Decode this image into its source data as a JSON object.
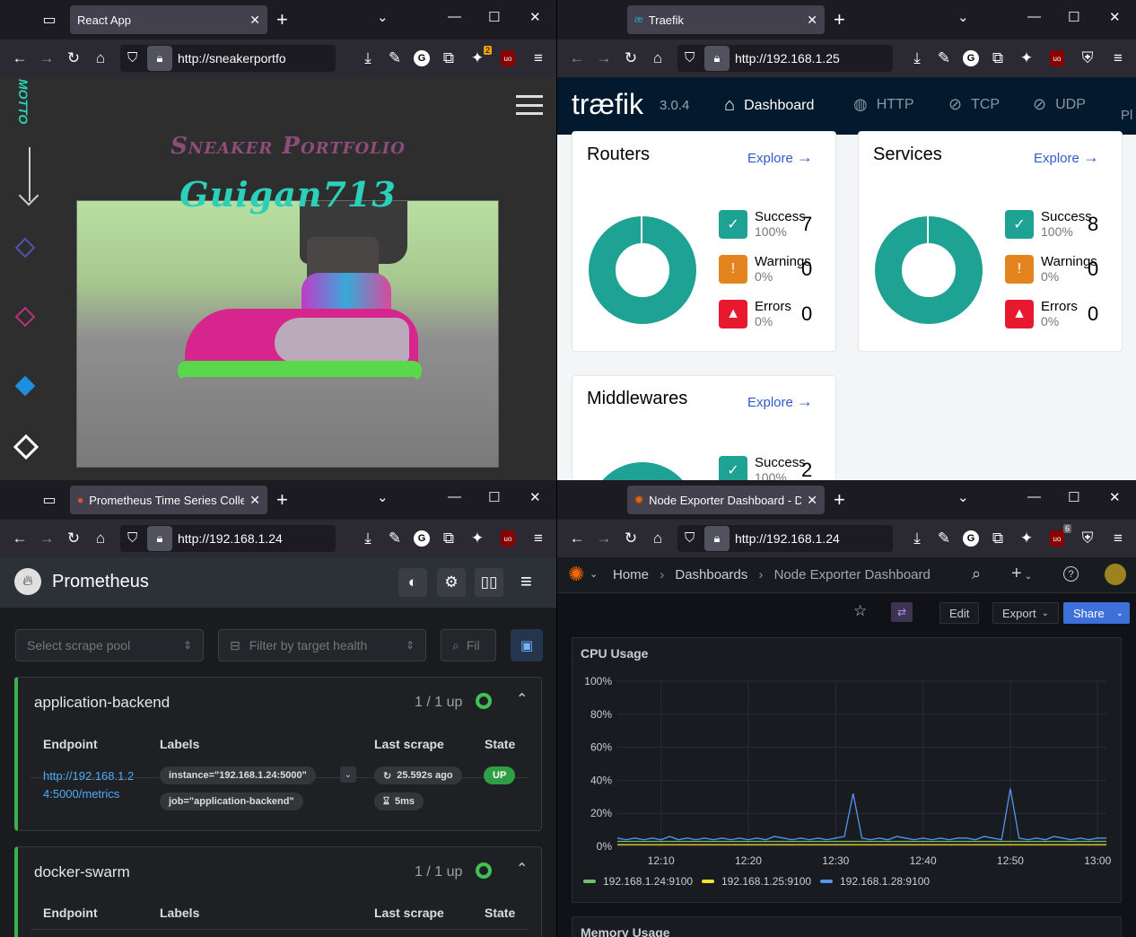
{
  "windows": {
    "sneaker": {
      "tab_title": "React App",
      "url": "http://sneakerportfo",
      "heading": "Sneaker Portfolio",
      "subheading": "Guigan713",
      "side_text": "MOTTO",
      "ext_badge": "2",
      "colors": {
        "heading": "#8d4c7a",
        "subheading": "#2ad1b8"
      }
    },
    "traefik": {
      "tab_title": "Traefik",
      "url": "http://192.168.1.25",
      "logo": "træfik",
      "version": "3.0.4",
      "nav": [
        "Dashboard",
        "HTTP",
        "TCP",
        "UDP",
        "Pl"
      ],
      "explore_label": "Explore",
      "cards": [
        {
          "title": "Routers",
          "success": "7",
          "warnings": "0",
          "errors": "0"
        },
        {
          "title": "Services",
          "success": "8",
          "warnings": "0",
          "errors": "0"
        },
        {
          "title": "Middlewares",
          "success": "2"
        }
      ],
      "labels": {
        "success": "Success",
        "warnings": "Warnings",
        "errors": "Errors",
        "pct_full": "100%",
        "pct_zero": "0%"
      }
    },
    "prometheus": {
      "tab_title": "Prometheus Time Series Collect",
      "url": "http://192.168.1.24",
      "app_name": "Prometheus",
      "filters": {
        "pool_placeholder": "Select scrape pool",
        "health_placeholder": "Filter by target health",
        "text_placeholder": "Fil"
      },
      "columns": [
        "Endpoint",
        "Labels",
        "Last scrape",
        "State"
      ],
      "pools": [
        {
          "name": "application-backend",
          "up": "1 / 1 up",
          "endpoint_line1": "http://192.168.1.2",
          "endpoint_line2": "4:5000/metrics",
          "label1": "instance=\"192.168.1.24:5000\"",
          "label2": "job=\"application-backend\"",
          "last_scrape": "25.592s ago",
          "duration": "5ms",
          "state": "UP"
        },
        {
          "name": "docker-swarm",
          "up": "1 / 1 up"
        }
      ]
    },
    "grafana": {
      "tab_title": "Node Exporter Dashboard - Das",
      "url": "http://192.168.1.24",
      "ext_badge": "6",
      "breadcrumb": [
        "Home",
        "Dashboards",
        "Node Exporter Dashboard"
      ],
      "buttons": {
        "edit": "Edit",
        "export": "Export",
        "share": "Share"
      },
      "panel_title": "CPU Usage",
      "next_panel_title": "Memory Usage"
    }
  },
  "chart_data": {
    "type": "line",
    "title": "CPU Usage",
    "x": [
      "12:05",
      "12:06",
      "12:07",
      "12:08",
      "12:09",
      "12:10",
      "12:11",
      "12:12",
      "12:13",
      "12:14",
      "12:15",
      "12:16",
      "12:17",
      "12:18",
      "12:19",
      "12:20",
      "12:21",
      "12:22",
      "12:23",
      "12:24",
      "12:25",
      "12:26",
      "12:27",
      "12:28",
      "12:29",
      "12:30",
      "12:31",
      "12:32",
      "12:33",
      "12:34",
      "12:35",
      "12:36",
      "12:37",
      "12:38",
      "12:39",
      "12:40",
      "12:41",
      "12:42",
      "12:43",
      "12:44",
      "12:45",
      "12:46",
      "12:47",
      "12:48",
      "12:49",
      "12:50",
      "12:51",
      "12:52",
      "12:53",
      "12:54",
      "12:55",
      "12:56",
      "12:57",
      "12:58",
      "12:59",
      "13:00",
      "13:01"
    ],
    "xticks": [
      "12:10",
      "12:20",
      "12:30",
      "12:40",
      "12:50",
      "13:00"
    ],
    "yticks": [
      "0%",
      "20%",
      "40%",
      "60%",
      "80%",
      "100%"
    ],
    "ylim": [
      0,
      100
    ],
    "series": [
      {
        "name": "192.168.1.24:9100",
        "color": "#73bf69",
        "values": [
          3,
          3,
          3,
          3,
          3,
          3,
          3,
          3,
          3,
          3,
          3,
          3,
          3,
          3,
          3,
          3,
          3,
          3,
          3,
          3,
          3,
          3,
          3,
          3,
          3,
          3,
          3,
          3,
          3,
          3,
          3,
          3,
          3,
          3,
          3,
          3,
          3,
          3,
          3,
          3,
          3,
          3,
          3,
          3,
          3,
          3,
          3,
          3,
          3,
          3,
          3,
          3,
          3,
          3,
          3,
          3,
          3
        ]
      },
      {
        "name": "192.168.1.25:9100",
        "color": "#fade2a",
        "values": [
          1,
          1,
          1,
          1,
          1,
          1,
          1,
          1,
          1,
          1,
          1,
          1,
          1,
          1,
          1,
          1,
          1,
          1,
          1,
          1,
          1,
          1,
          1,
          1,
          1,
          1,
          1,
          1,
          1,
          1,
          1,
          1,
          1,
          1,
          1,
          1,
          1,
          1,
          1,
          1,
          1,
          1,
          1,
          1,
          1,
          1,
          1,
          1,
          1,
          1,
          1,
          1,
          1,
          1,
          1,
          1,
          1
        ]
      },
      {
        "name": "192.168.1.28:9100",
        "color": "#5794f2",
        "values": [
          5,
          4,
          5,
          4,
          5,
          4,
          6,
          4,
          5,
          4,
          5,
          4,
          5,
          4,
          5,
          4,
          5,
          4,
          6,
          5,
          4,
          5,
          4,
          5,
          4,
          5,
          6,
          32,
          5,
          4,
          5,
          4,
          6,
          5,
          4,
          5,
          4,
          5,
          4,
          5,
          5,
          4,
          6,
          5,
          4,
          35,
          5,
          4,
          5,
          4,
          6,
          5,
          4,
          5,
          4,
          5,
          5
        ]
      }
    ],
    "legend": "bottom"
  }
}
